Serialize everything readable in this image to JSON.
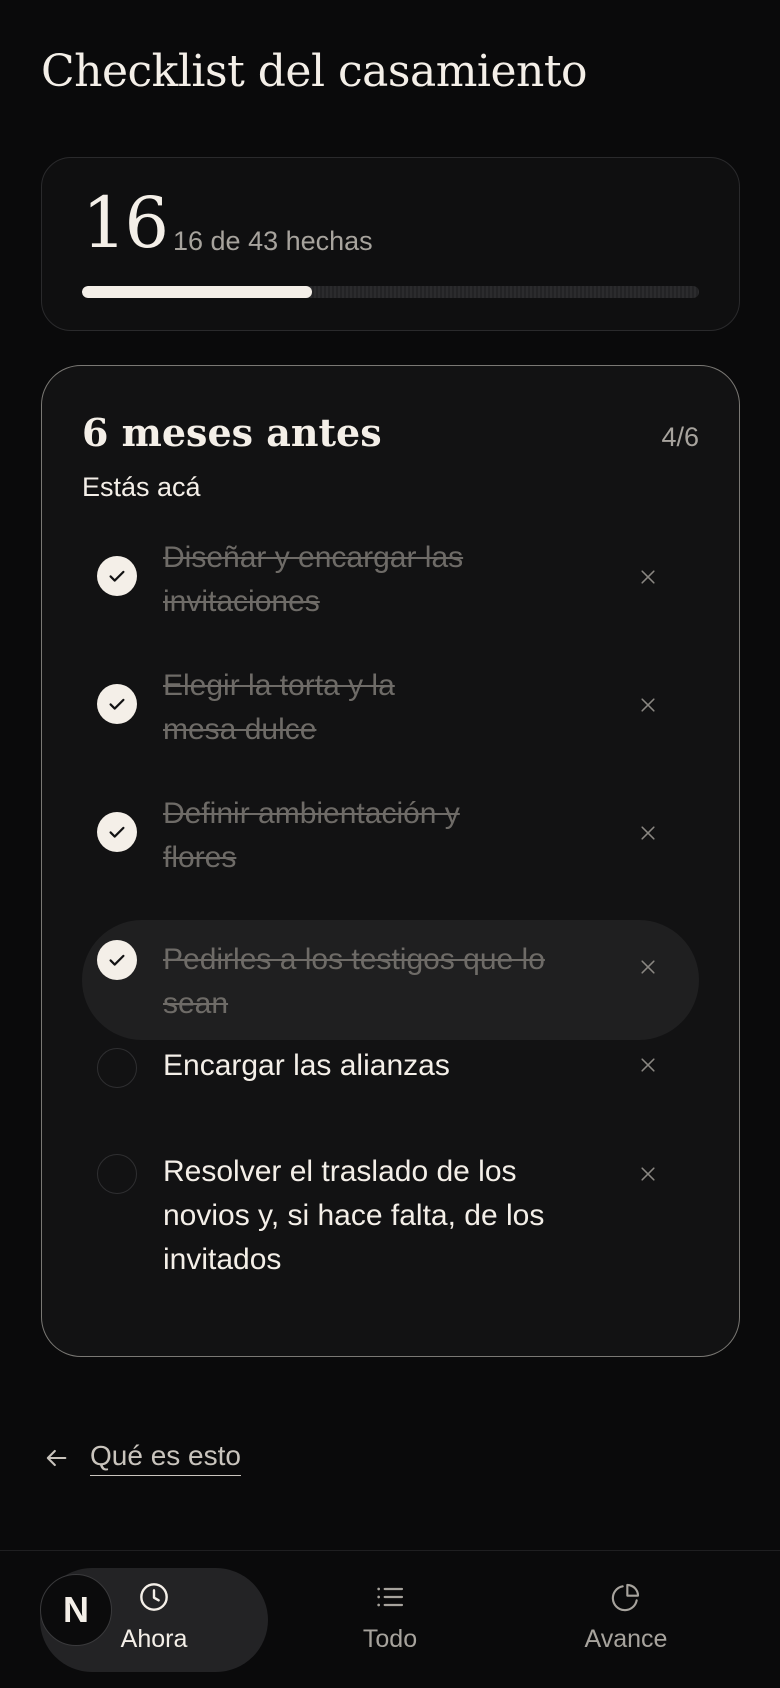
{
  "page": {
    "title": "Checklist del casamiento"
  },
  "progress": {
    "done": "16",
    "label": "16 de 43 hechas",
    "fraction": 0.372
  },
  "phase": {
    "title": "6 meses antes",
    "count": "4/6",
    "subtitle": "Estás acá"
  },
  "tasks": [
    {
      "text": "Diseñar y encargar las invitaciones",
      "done": true
    },
    {
      "text": "Elegir la torta y la mesa dulce",
      "done": true
    },
    {
      "text": "Definir ambientación y flores",
      "done": true
    },
    {
      "text": "Pedirles a los testigos que lo sean",
      "done": true,
      "highlighted": true
    },
    {
      "text": "Encargar las alianzas",
      "done": false
    },
    {
      "text": "Resolver el traslado de los novios y, si hace falta, de los invitados",
      "done": false
    }
  ],
  "footer": {
    "link_label": "Qué es esto"
  },
  "nav": {
    "avatar_letter": "N",
    "items": [
      {
        "label": "Ahora",
        "icon": "clock-icon",
        "active": true
      },
      {
        "label": "Todo",
        "icon": "list-icon",
        "active": false
      },
      {
        "label": "Avance",
        "icon": "pie-chart-icon",
        "active": false
      }
    ]
  },
  "colors": {
    "background": "#0a0a0b",
    "text": "#f4efe8",
    "muted": "#a7a39d",
    "done_text": "#6e6b67"
  }
}
